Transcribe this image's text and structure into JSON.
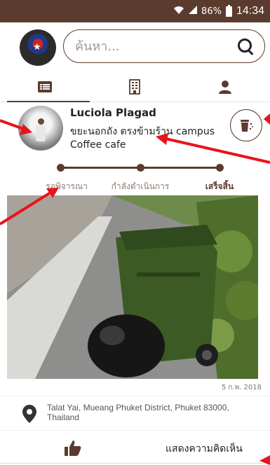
{
  "status_bar": {
    "battery": "86%",
    "time": "14:34"
  },
  "search": {
    "placeholder": "ค้นหา..."
  },
  "tabs": [
    {
      "icon": "list-icon",
      "active": true
    },
    {
      "icon": "building-icon",
      "active": false
    },
    {
      "icon": "person-icon",
      "active": false
    }
  ],
  "post": {
    "author": "Luciola Plagad",
    "caption": "ขยะนอกถัง ตรงข้ามร้าน campus Coffee cafe",
    "steps": [
      {
        "label": "รอพิจารณา",
        "done": false
      },
      {
        "label": "กำลังดำเนินการ",
        "done": false
      },
      {
        "label": "เสร็จสิ้น",
        "done": true
      }
    ],
    "date": "5 ก.พ. 2018",
    "location": "Talat Yai, Mueang Phuket District, Phuket 83000, Thailand",
    "comment_label": "แสดงความคิดเห็น"
  },
  "colors": {
    "brand": "#5a3b2e",
    "annotation": "#e8141c"
  }
}
